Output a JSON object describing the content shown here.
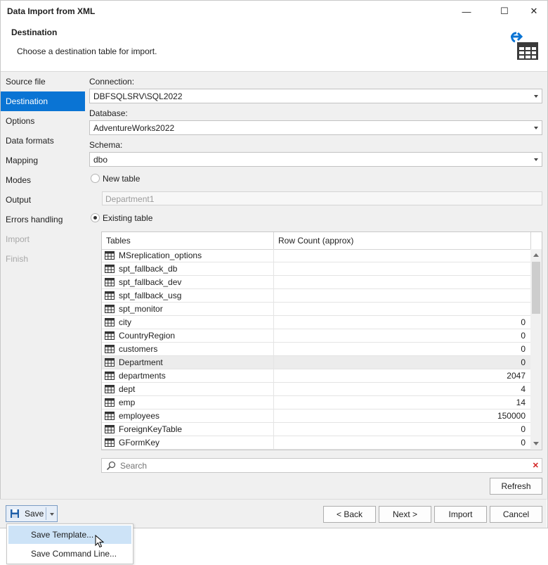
{
  "window": {
    "title": "Data Import from XML",
    "minimize_glyph": "—",
    "maximize_glyph": "☐",
    "close_glyph": "✕"
  },
  "header": {
    "title": "Destination",
    "description": "Choose a destination table for import.",
    "icon": "import-to-table-icon"
  },
  "sidebar": {
    "items": [
      {
        "label": "Source file",
        "state": "normal"
      },
      {
        "label": "Destination",
        "state": "active"
      },
      {
        "label": "Options",
        "state": "normal"
      },
      {
        "label": "Data formats",
        "state": "normal"
      },
      {
        "label": "Mapping",
        "state": "normal"
      },
      {
        "label": "Modes",
        "state": "normal"
      },
      {
        "label": "Output",
        "state": "normal"
      },
      {
        "label": "Errors handling",
        "state": "normal"
      },
      {
        "label": "Import",
        "state": "disabled"
      },
      {
        "label": "Finish",
        "state": "disabled"
      }
    ]
  },
  "form": {
    "connection_label": "Connection:",
    "connection_value": "DBFSQLSRV\\SQL2022",
    "database_label": "Database:",
    "database_value": "AdventureWorks2022",
    "schema_label": "Schema:",
    "schema_value": "dbo",
    "new_table_label": "New table",
    "new_table_value": "Department1",
    "existing_table_label": "Existing table",
    "selected_option": "existing_table"
  },
  "grid": {
    "columns": [
      "Tables",
      "Row Count (approx)"
    ],
    "rows": [
      {
        "name": "MSreplication_options",
        "count": ""
      },
      {
        "name": "spt_fallback_db",
        "count": ""
      },
      {
        "name": "spt_fallback_dev",
        "count": ""
      },
      {
        "name": "spt_fallback_usg",
        "count": ""
      },
      {
        "name": "spt_monitor",
        "count": ""
      },
      {
        "name": "city",
        "count": "0"
      },
      {
        "name": "CountryRegion",
        "count": "0"
      },
      {
        "name": "customers",
        "count": "0"
      },
      {
        "name": "Department",
        "count": "0",
        "selected": true
      },
      {
        "name": "departments",
        "count": "2047"
      },
      {
        "name": "dept",
        "count": "4"
      },
      {
        "name": "emp",
        "count": "14"
      },
      {
        "name": "employees",
        "count": "150000"
      },
      {
        "name": "ForeignKeyTable",
        "count": "0"
      },
      {
        "name": "GFormKey",
        "count": "0"
      }
    ]
  },
  "search": {
    "placeholder": "Search",
    "icon": "search-icon",
    "clear_glyph": "✕"
  },
  "buttons": {
    "refresh": "Refresh",
    "save": "Save",
    "back": "< Back",
    "next": "Next >",
    "import": "Import",
    "cancel": "Cancel"
  },
  "save_menu": {
    "items": [
      "Save Template...",
      "Save Command Line..."
    ]
  },
  "colors": {
    "accent": "#0a74d4",
    "menu_hover": "#cde3f7",
    "clear_red": "#d21f1f"
  }
}
